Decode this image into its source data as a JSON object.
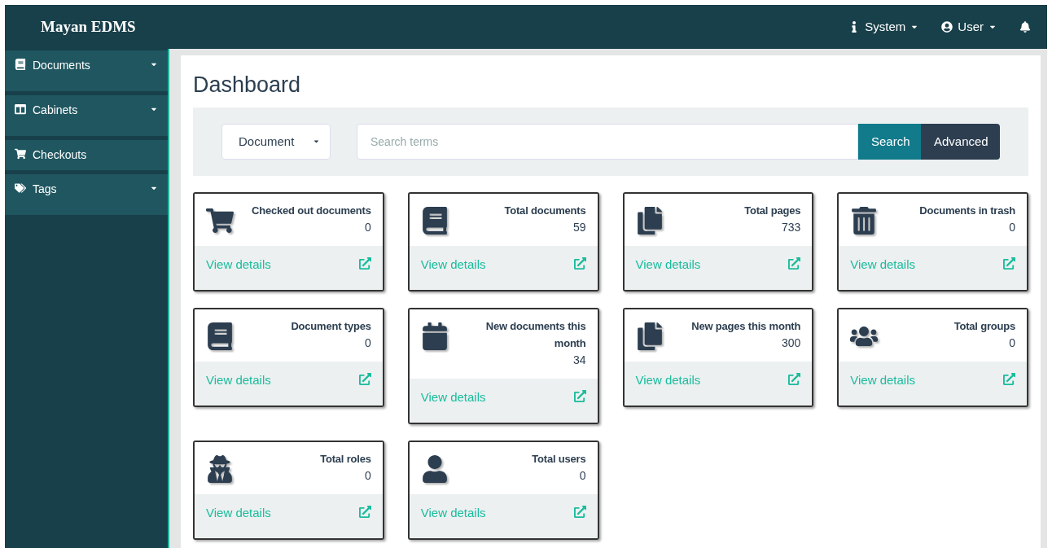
{
  "navbar": {
    "brand": "Mayan EDMS",
    "menus": [
      {
        "kind": "info",
        "label": "System"
      },
      {
        "kind": "user",
        "label": "User"
      }
    ]
  },
  "sidebar": {
    "items": [
      {
        "kind": "book",
        "label": "Documents",
        "expandable": true
      },
      {
        "kind": "columns",
        "label": "Cabinets",
        "expandable": true
      },
      {
        "kind": "cart",
        "label": "Checkouts",
        "expandable": false
      },
      {
        "kind": "tags",
        "label": "Tags",
        "expandable": true
      }
    ]
  },
  "page": {
    "title": "Dashboard"
  },
  "search": {
    "model": "Document",
    "placeholder": "Search terms",
    "buttons": [
      "Search",
      "Advanced"
    ]
  },
  "cards": [
    {
      "kind": "cart",
      "title": "Checked out documents",
      "count": "0",
      "link": "View details"
    },
    {
      "kind": "book",
      "title": "Total documents",
      "count": "59",
      "link": "View details"
    },
    {
      "kind": "pages",
      "title": "Total pages",
      "count": "733",
      "link": "View details"
    },
    {
      "kind": "trash",
      "title": "Documents in trash",
      "count": "0",
      "link": "View details"
    },
    {
      "kind": "booktype",
      "title": "Document types",
      "count": "0",
      "link": "View details"
    },
    {
      "kind": "calendar",
      "title": "New documents this month",
      "count": "34",
      "link": "View details"
    },
    {
      "kind": "pages",
      "title": "New pages this month",
      "count": "300",
      "link": "View details"
    },
    {
      "kind": "groups",
      "title": "Total groups",
      "count": "0",
      "link": "View details"
    },
    {
      "kind": "spy",
      "title": "Total roles",
      "count": "0",
      "link": "View details"
    },
    {
      "kind": "user",
      "title": "Total users",
      "count": "0",
      "link": "View details"
    }
  ]
}
